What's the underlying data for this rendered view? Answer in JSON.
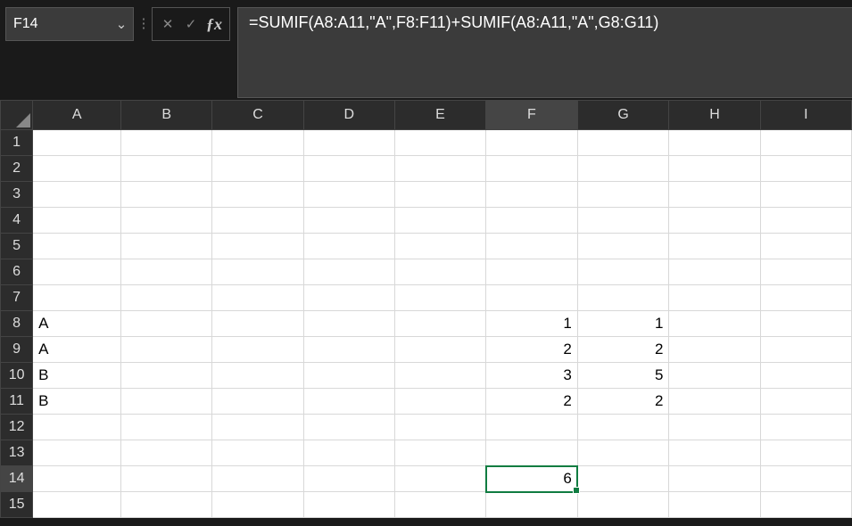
{
  "namebox": {
    "value": "F14"
  },
  "formula_bar": {
    "value": "=SUMIF(A8:A11,\"A\",F8:F11)+SUMIF(A8:A11,\"A\",G8:G11)"
  },
  "columns": [
    "A",
    "B",
    "C",
    "D",
    "E",
    "F",
    "G",
    "H",
    "I"
  ],
  "rows": [
    "1",
    "2",
    "3",
    "4",
    "5",
    "6",
    "7",
    "8",
    "9",
    "10",
    "11",
    "12",
    "13",
    "14",
    "15"
  ],
  "selected": {
    "col": "F",
    "row": "14"
  },
  "cells": {
    "A8": {
      "v": "A",
      "align": "l"
    },
    "A9": {
      "v": "A",
      "align": "l"
    },
    "A10": {
      "v": "B",
      "align": "l"
    },
    "A11": {
      "v": "B",
      "align": "l"
    },
    "F8": {
      "v": "1",
      "align": "r"
    },
    "F9": {
      "v": "2",
      "align": "r"
    },
    "F10": {
      "v": "3",
      "align": "r"
    },
    "F11": {
      "v": "2",
      "align": "r"
    },
    "G8": {
      "v": "1",
      "align": "r"
    },
    "G9": {
      "v": "2",
      "align": "r"
    },
    "G10": {
      "v": "5",
      "align": "r"
    },
    "G11": {
      "v": "2",
      "align": "r"
    },
    "F14": {
      "v": "6",
      "align": "r"
    }
  },
  "icons": {
    "cancel": "✕",
    "confirm": "✓",
    "sep": "⋮",
    "caret": "⌄"
  },
  "chart_data": {
    "type": "table",
    "description": "spreadsheet data range A8:G11 with SUMIF result in F14",
    "headers": [
      "A",
      "F",
      "G"
    ],
    "rows": [
      {
        "A": "A",
        "F": 1,
        "G": 1
      },
      {
        "A": "A",
        "F": 2,
        "G": 2
      },
      {
        "A": "B",
        "F": 3,
        "G": 5
      },
      {
        "A": "B",
        "F": 2,
        "G": 2
      }
    ],
    "result_cell": {
      "ref": "F14",
      "value": 6,
      "formula": "=SUMIF(A8:A11,\"A\",F8:F11)+SUMIF(A8:A11,\"A\",G8:G11)"
    }
  }
}
